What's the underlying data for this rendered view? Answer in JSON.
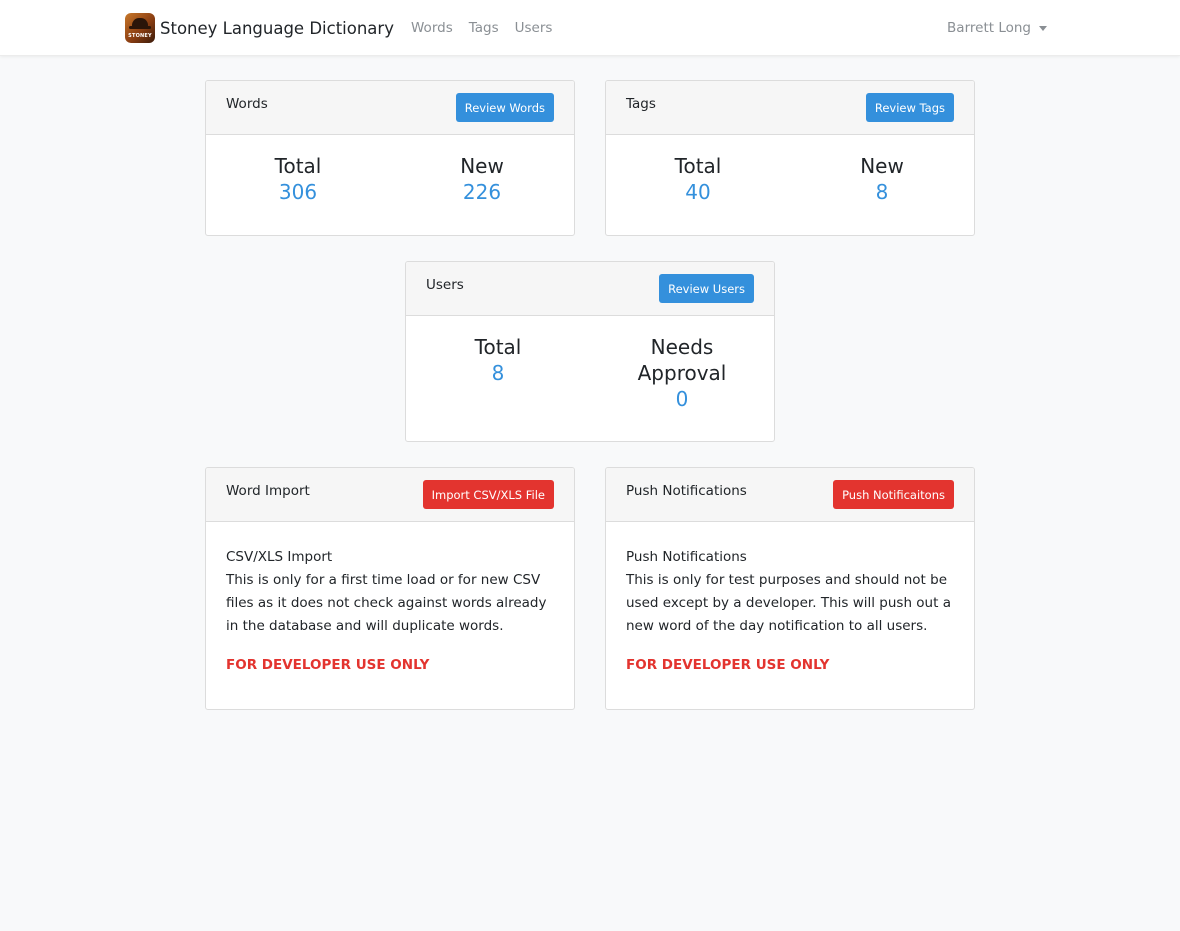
{
  "navbar": {
    "brand_name": "Stoney Language Dictionary",
    "logo_text": "STONEY",
    "links": [
      "Words",
      "Tags",
      "Users"
    ],
    "user_name": "Barrett Long"
  },
  "words_card": {
    "title": "Words",
    "button": "Review Words",
    "stats": [
      {
        "label": "Total",
        "value": "306"
      },
      {
        "label": "New",
        "value": "226"
      }
    ]
  },
  "tags_card": {
    "title": "Tags",
    "button": "Review Tags",
    "stats": [
      {
        "label": "Total",
        "value": "40"
      },
      {
        "label": "New",
        "value": "8"
      }
    ]
  },
  "users_card": {
    "title": "Users",
    "button": "Review Users",
    "stats": [
      {
        "label": "Total",
        "value": "8"
      },
      {
        "label_line1": "Needs",
        "label_line2": "Approval",
        "value": "0"
      }
    ]
  },
  "import_card": {
    "title": "Word Import",
    "button": "Import CSV/XLS File",
    "heading": "CSV/XLS Import",
    "text": "This is only for a first time load or for new CSV files as it does not check against words already in the database and will duplicate words.",
    "warning": "FOR DEVELOPER USE ONLY"
  },
  "push_card": {
    "title": "Push Notifications",
    "button": "Push Notificaitons",
    "heading": "Push Notifications",
    "text": "This is only for test purposes and should not be used except by a developer. This will push out a new word of the day notification to all users.",
    "warning": "FOR DEVELOPER USE ONLY"
  },
  "colors": {
    "primary": "#3490dc",
    "danger": "#e3342f",
    "background": "#f8f9fa"
  }
}
